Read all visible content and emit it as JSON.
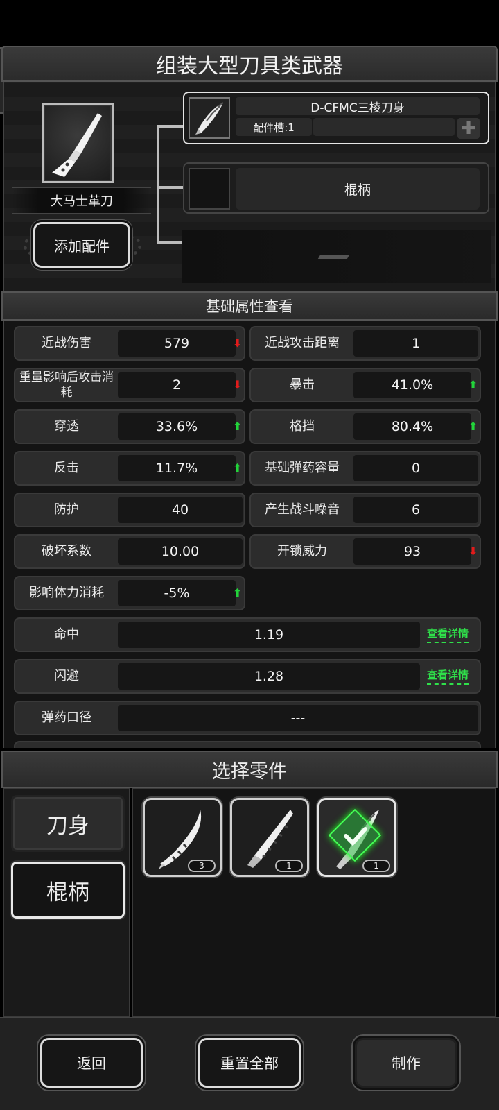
{
  "header": {
    "title": "组装大型刀具类武器"
  },
  "weapon": {
    "name": "大马士革刀",
    "add_button": "添加配件"
  },
  "slots": [
    {
      "name": "D-CFMC三棱刀身",
      "sub": "配件槽:1",
      "plus": "✚",
      "state": "filled"
    },
    {
      "name": "棍柄",
      "state": "empty"
    },
    {
      "name": "",
      "state": "locked"
    }
  ],
  "stats": {
    "title": "基础属性查看",
    "pairs": [
      {
        "label": "近战伤害",
        "value": "579",
        "change": "down"
      },
      {
        "label": "近战攻击距离",
        "value": "1",
        "change": "none"
      },
      {
        "label": "重量影响后攻击消耗",
        "value": "2",
        "change": "down"
      },
      {
        "label": "暴击",
        "value": "41.0%",
        "change": "up"
      },
      {
        "label": "穿透",
        "value": "33.6%",
        "change": "up"
      },
      {
        "label": "格挡",
        "value": "80.4%",
        "change": "up"
      },
      {
        "label": "反击",
        "value": "11.7%",
        "change": "up"
      },
      {
        "label": "基础弹药容量",
        "value": "0",
        "change": "none"
      },
      {
        "label": "防护",
        "value": "40",
        "change": "none"
      },
      {
        "label": "产生战斗噪音",
        "value": "6",
        "change": "none"
      },
      {
        "label": "破坏系数",
        "value": "10.00",
        "change": "none"
      },
      {
        "label": "开锁威力",
        "value": "93",
        "change": "down"
      },
      {
        "label": "影响体力消耗",
        "value": "-5%",
        "change": "up"
      }
    ],
    "wide": [
      {
        "label": "命中",
        "value": "1.19",
        "link": "查看详情"
      },
      {
        "label": "闪避",
        "value": "1.28",
        "link": "查看详情"
      },
      {
        "label": "弹药口径",
        "value": "---",
        "link": ""
      }
    ]
  },
  "parts": {
    "title": "选择零件",
    "categories": [
      {
        "label": "刀身",
        "active": false
      },
      {
        "label": "棍柄",
        "active": true
      }
    ],
    "items": [
      {
        "count": "3",
        "selected": false
      },
      {
        "count": "1",
        "selected": false
      },
      {
        "count": "1",
        "selected": true
      }
    ]
  },
  "footer": {
    "back": "返回",
    "reset": "重置全部",
    "make": "制作"
  },
  "colors": {
    "up": "#22d43a",
    "down": "#e21b1b",
    "link": "#2fe04a"
  }
}
